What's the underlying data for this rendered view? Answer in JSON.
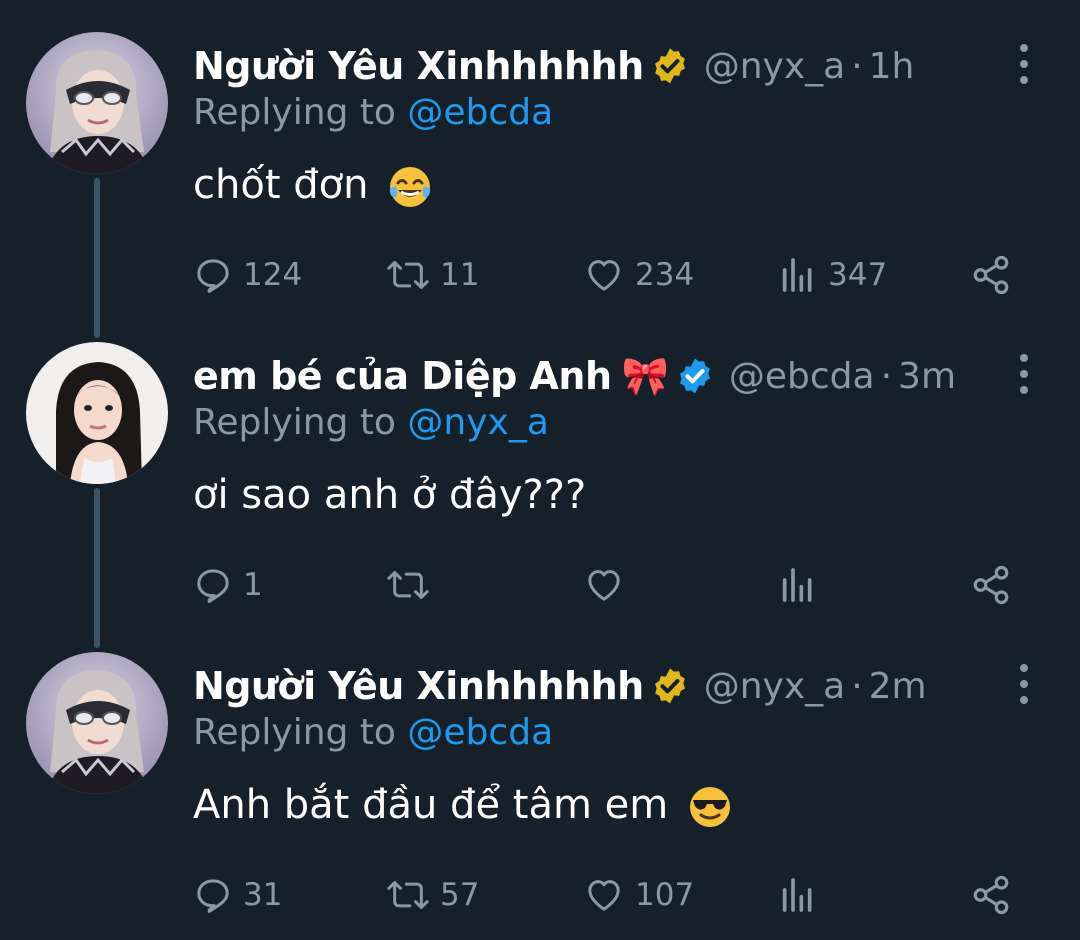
{
  "tweets": [
    {
      "name": "Người Yêu Xinhhhhhh",
      "handle": "@nyx_a",
      "separator": "·",
      "time": "1h",
      "replying_prefix": "Replying to",
      "replying_to": "@ebcda",
      "text": "chốt đơn",
      "emoji": "face-with-tears-of-joy",
      "badge_color": "#e2b719",
      "stats": {
        "replies": "124",
        "retweets": "11",
        "likes": "234",
        "views": "347"
      }
    },
    {
      "name": "em bé của Diệp Anh",
      "name_emoji": "🎀",
      "handle": "@ebcda",
      "separator": "·",
      "time": "3m",
      "replying_prefix": "Replying to",
      "replying_to": "@nyx_a",
      "text": "ơi sao anh ở đây???",
      "badge_color": "#1d9bf0",
      "stats": {
        "replies": "1",
        "retweets": "",
        "likes": "",
        "views": ""
      }
    },
    {
      "name": "Người Yêu Xinhhhhhh",
      "handle": "@nyx_a",
      "separator": "·",
      "time": "2m",
      "replying_prefix": "Replying to",
      "replying_to": "@ebcda",
      "text": "Anh bắt đầu để tâm em",
      "emoji": "smiling-face-with-sunglasses",
      "badge_color": "#e2b719",
      "stats": {
        "replies": "31",
        "retweets": "57",
        "likes": "107",
        "views": ""
      }
    }
  ],
  "colors": {
    "background": "#15202b",
    "secondary_text": "#8b98a5",
    "link": "#1d9bf0",
    "thread_line": "#3d5466"
  }
}
